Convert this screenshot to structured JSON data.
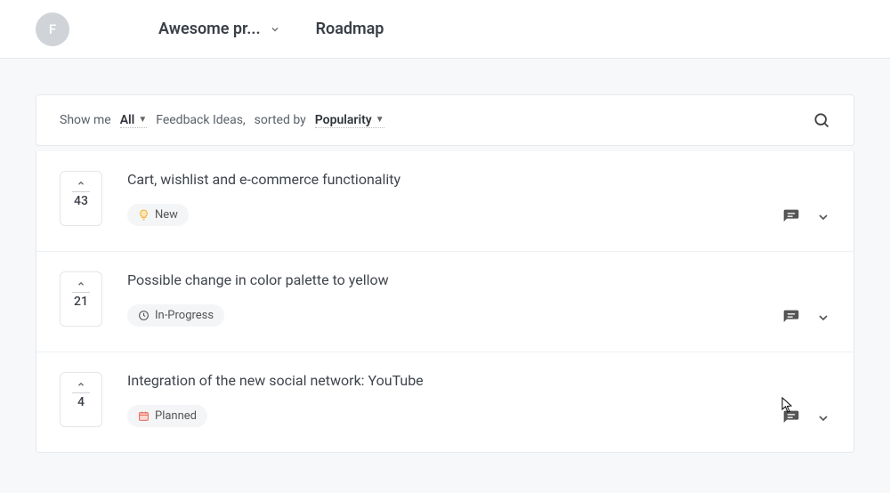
{
  "header": {
    "avatar_letter": "F",
    "project_name": "Awesome pr...",
    "nav_roadmap": "Roadmap"
  },
  "filter": {
    "show_me": "Show me",
    "all": "All",
    "feedback_ideas_label": "Feedback Ideas,",
    "sorted_by": "sorted by",
    "popularity": "Popularity"
  },
  "items": [
    {
      "votes": "43",
      "title": "Cart, wishlist and e-commerce functionality",
      "status_label": "New",
      "status_icon": "bulb",
      "status_color": "#f5b342"
    },
    {
      "votes": "21",
      "title": "Possible change in color palette to yellow",
      "status_label": "In-Progress",
      "status_icon": "clock",
      "status_color": "#555"
    },
    {
      "votes": "4",
      "title": "Integration of the new social network: YouTube",
      "status_label": "Planned",
      "status_icon": "calendar",
      "status_color": "#e86a5a"
    }
  ]
}
